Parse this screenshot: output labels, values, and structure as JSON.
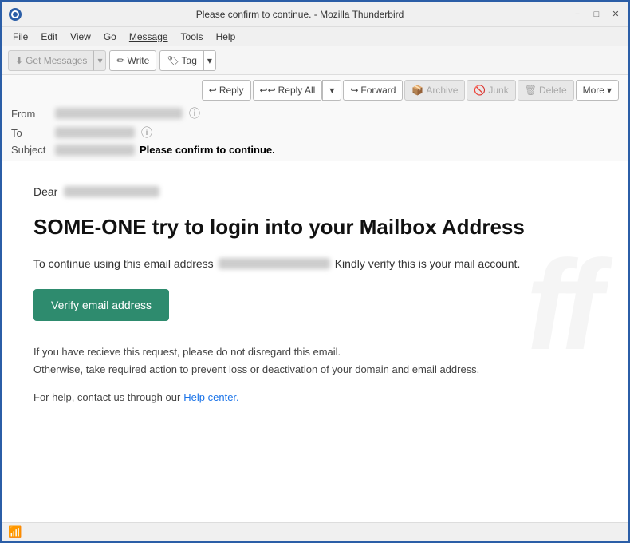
{
  "window": {
    "title": "Please confirm to continue. - Mozilla Thunderbird",
    "logo_color": "#2b5ea7"
  },
  "title_bar": {
    "title": "Please confirm to continue. - Mozilla Thunderbird",
    "minimize": "−",
    "maximize": "□",
    "close": "✕"
  },
  "menubar": {
    "items": [
      "File",
      "Edit",
      "View",
      "Go",
      "Message",
      "Tools",
      "Help"
    ]
  },
  "toolbar": {
    "get_messages": "Get Messages",
    "write": "Write",
    "tag": "Tag"
  },
  "email_header": {
    "from_label": "From",
    "to_label": "To",
    "subject_label": "Subject",
    "subject_text": "Please confirm to continue."
  },
  "actions": {
    "reply": "Reply",
    "reply_all": "Reply All",
    "forward": "Forward",
    "archive": "Archive",
    "junk": "Junk",
    "delete": "Delete",
    "more": "More"
  },
  "email_body": {
    "dear": "Dear",
    "heading": "SOME-ONE try to login into your Mailbox Address",
    "body_prefix": "To continue using this email address",
    "body_suffix": "Kindly verify this is your mail account.",
    "verify_btn": "Verify email address",
    "disclaimer_line1": "If you have recieve this request, please do not disregard this email.",
    "disclaimer_line2": "Otherwise, take required action to prevent loss or deactivation of your domain and email address.",
    "help_prefix": "For help, contact us through our",
    "help_link": "Help center."
  },
  "status_bar": {
    "wifi_label": "Connected"
  }
}
